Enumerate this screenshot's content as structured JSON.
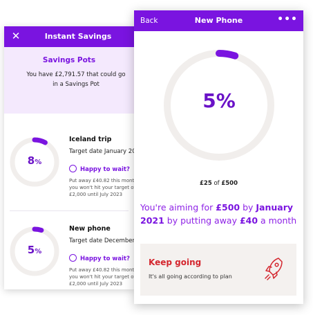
{
  "back_screen": {
    "title": "Instant Savings",
    "close_glyph": "✕",
    "savings_pots": {
      "heading": "Savings Pots",
      "description": "You have £2,791.57 that could go in a Savings Pot"
    },
    "pots": [
      {
        "percent": "8",
        "percent_sign": "%",
        "progress_fraction": 0.08,
        "name": "Iceland trip",
        "target": "Target date January 20",
        "wait_label": "Happy to wait?",
        "note": "Put away £40.82 this month you won't hit your target of £2,000 until July 2023"
      },
      {
        "percent": "5",
        "percent_sign": "%",
        "progress_fraction": 0.05,
        "name": "New phone",
        "target": "Target date December",
        "wait_label": "Happy to wait?",
        "note": "Put away £40.82 this month you won't hit your target of £2,000 until July 2023"
      }
    ]
  },
  "front_screen": {
    "back_label": "Back",
    "title": "New Phone",
    "more_glyph": "•••",
    "percent_text": "5%",
    "progress_fraction": 0.05,
    "saved": "£25",
    "of_word": "of",
    "target": "£500",
    "aim": {
      "part1": "You're aiming for ",
      "amount": "£500",
      "part2": " by ",
      "date": "January 2021",
      "part3": " by putting away ",
      "monthly": "£40",
      "part4": " a month"
    },
    "status": {
      "title": "Keep going",
      "description": "It's all going according to plan",
      "icon": "rocket-icon"
    }
  },
  "colors": {
    "brand_purple": "#7a14e0",
    "ring_track": "#f1eeec",
    "status_red": "#d4262e"
  }
}
